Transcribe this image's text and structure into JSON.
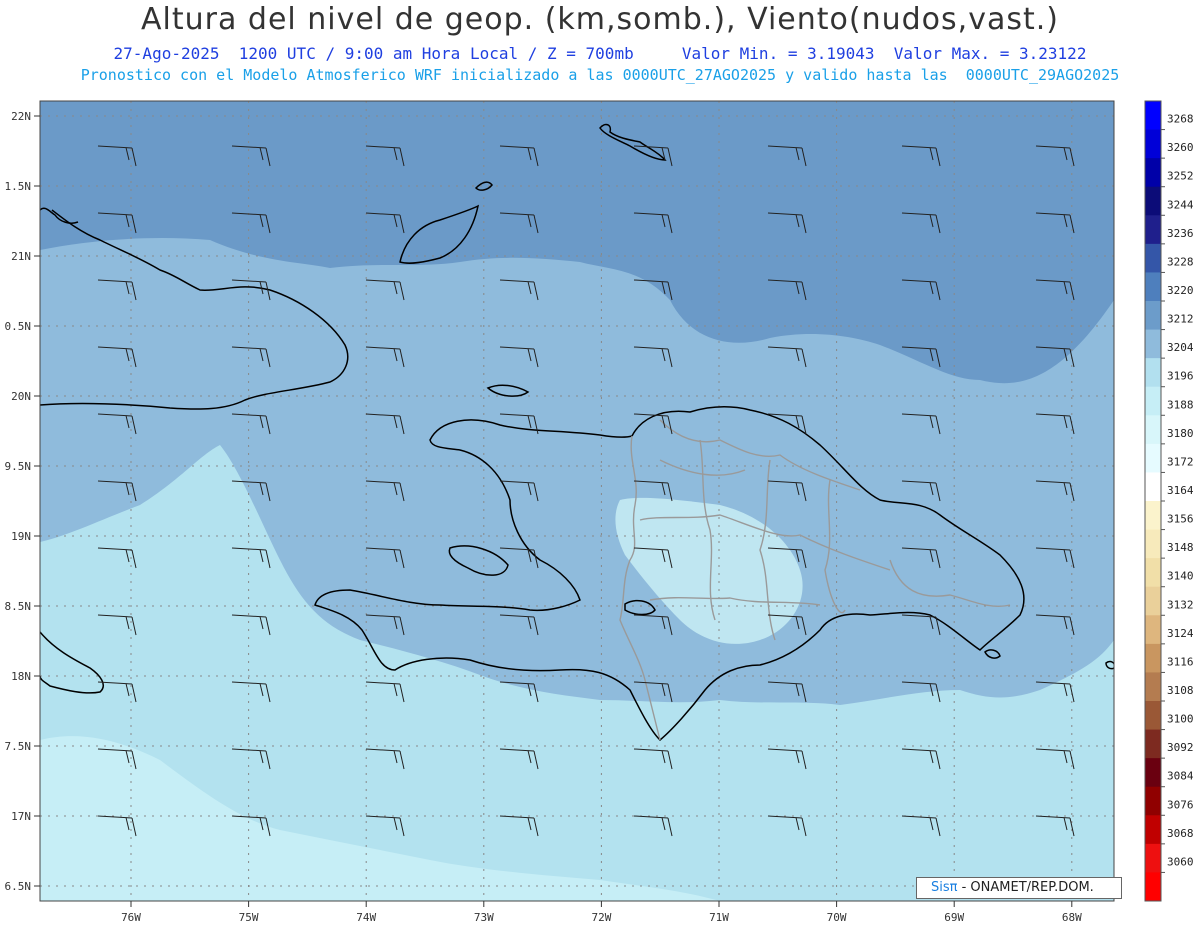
{
  "header": {
    "title": "Altura del nivel de geop. (km,somb.), Viento(nudos,vast.)",
    "subtitle": "27-Ago-2025  1200 UTC / 9:00 am Hora Local / Z = 700mb     Valor Min. = 3.19043  Valor Max. = 3.23122",
    "forecast_line": "Pronostico con el Modelo Atmosferico WRF inicializado a las 0000UTC_27AGO2025 y valido hasta las  0000UTC_29AGO2025"
  },
  "axes": {
    "lat_labels": [
      "22N",
      "1.5N",
      "21N",
      "0.5N",
      "20N",
      "9.5N",
      "19N",
      "8.5N",
      "18N",
      "7.5N",
      "17N",
      "6.5N"
    ],
    "lon_labels": [
      "76W",
      "75W",
      "74W",
      "73W",
      "72W",
      "71W",
      "70W",
      "69W",
      "68W"
    ]
  },
  "colorbar": {
    "levels": [
      "3268",
      "3260",
      "3252",
      "3244",
      "3236",
      "3228",
      "3220",
      "3212",
      "3204",
      "3196",
      "3188",
      "3180",
      "3172",
      "3164",
      "3156",
      "3148",
      "3140",
      "3132",
      "3124",
      "3116",
      "3108",
      "3100",
      "3092",
      "3084",
      "3076",
      "3068",
      "3060"
    ],
    "colors": [
      "#0000ff",
      "#0000d8",
      "#0000a8",
      "#0c0c78",
      "#1f1f8c",
      "#3456a8",
      "#4e7fbd",
      "#6c9cca",
      "#8fbbdc",
      "#b2e0ef",
      "#c6eef6",
      "#d8f6fa",
      "#e6fbff",
      "#ffffff",
      "#fbf3cc",
      "#f7eabb",
      "#f1dfa8",
      "#ead09a",
      "#deb67e",
      "#c99660",
      "#b47c50",
      "#9a5836",
      "#7d2a20",
      "#6a0010",
      "#900000",
      "#c00000",
      "#ee1010",
      "#ff0000"
    ]
  },
  "fills": {
    "north": "#6b9ac8",
    "middle": "#8fbbdc",
    "south": "#b3e2ef",
    "southmost": "#c6eef6",
    "land_interior": "#bfe6f1",
    "border": "#9a9a9a",
    "coast": "#000000",
    "grid": "#888888",
    "barb": "#222222"
  },
  "credit": {
    "brand": "Sisπ",
    "org": " - ONAMET/REP.DOM."
  }
}
